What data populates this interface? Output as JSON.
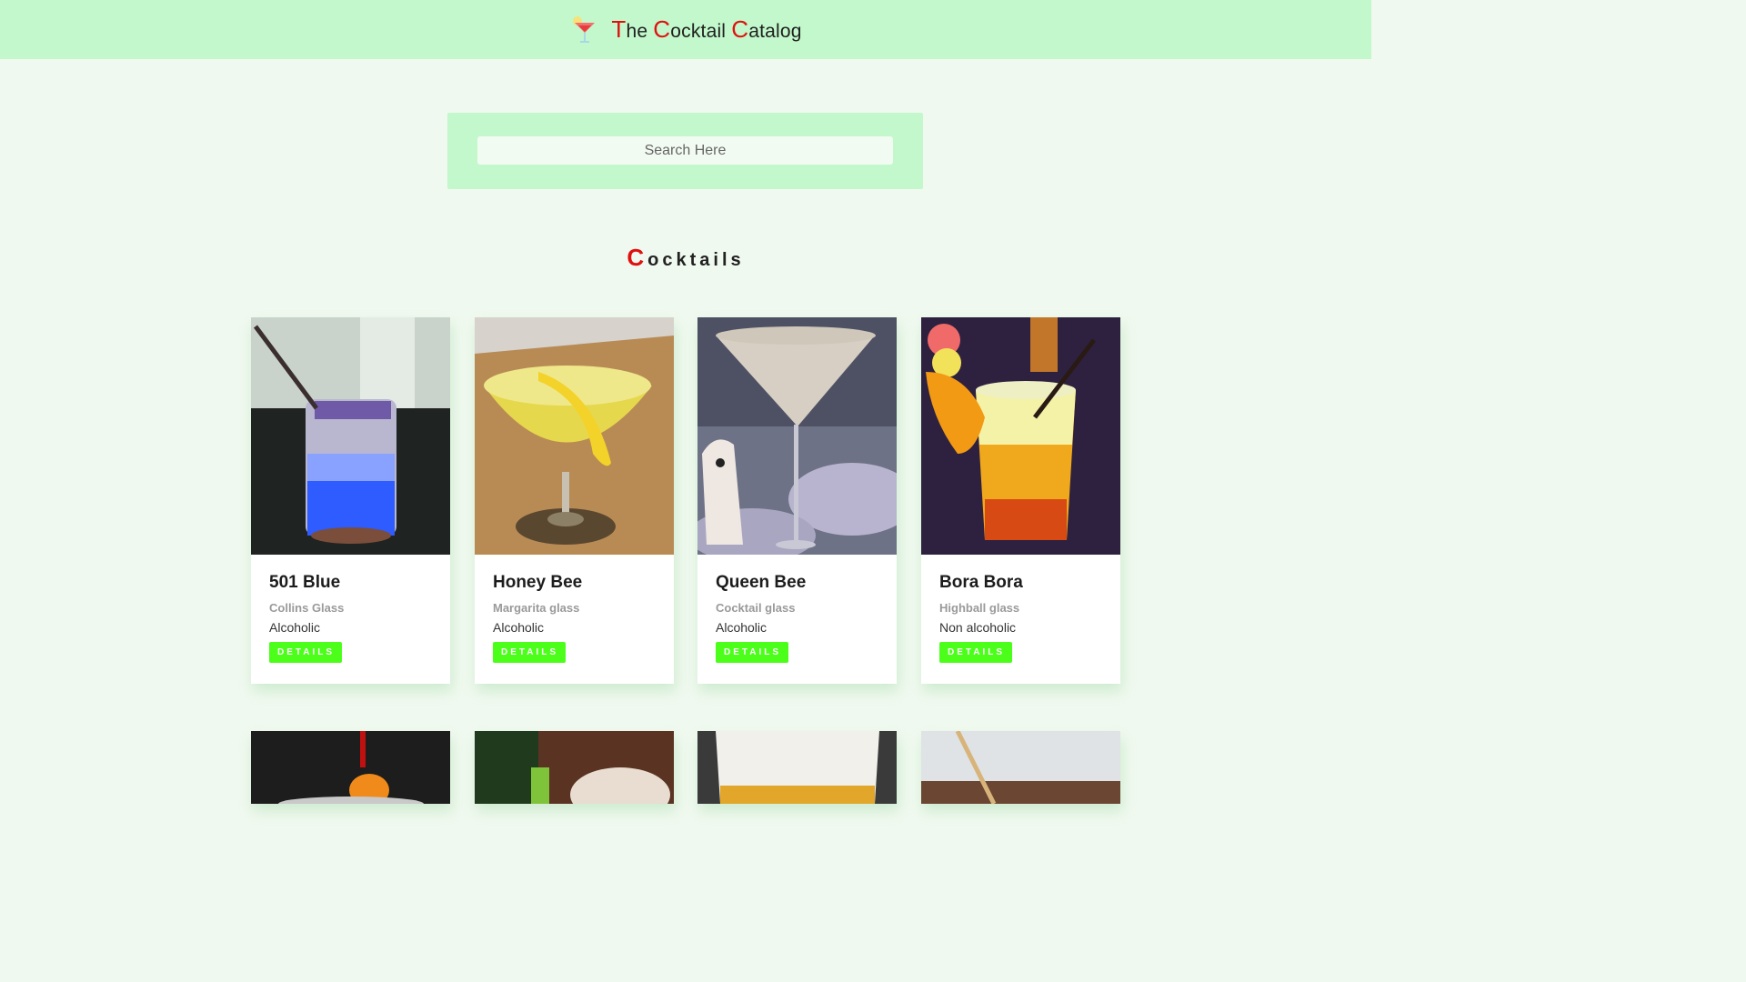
{
  "header": {
    "title_parts": [
      {
        "cap": "T",
        "rest": "he "
      },
      {
        "cap": "C",
        "rest": "ocktail "
      },
      {
        "cap": "C",
        "rest": "atalog"
      }
    ],
    "logo_icon": "cocktail-glass-icon"
  },
  "search": {
    "placeholder": "Search Here",
    "value": ""
  },
  "section": {
    "cap": "C",
    "rest": "ocktails"
  },
  "cards": [
    {
      "name": "501 Blue",
      "glass": "Collins Glass",
      "type": "Alcoholic",
      "button": "DETAILS"
    },
    {
      "name": "Honey Bee",
      "glass": "Margarita glass",
      "type": "Alcoholic",
      "button": "DETAILS"
    },
    {
      "name": "Queen Bee",
      "glass": "Cocktail glass",
      "type": "Alcoholic",
      "button": "DETAILS"
    },
    {
      "name": "Bora Bora",
      "glass": "Highball glass",
      "type": "Non alcoholic",
      "button": "DETAILS"
    }
  ],
  "colors": {
    "navbar": "#c2f8cb",
    "page_background": "#f0f9ef",
    "accent_red": "#e01010",
    "button_green": "#4cff1a"
  }
}
